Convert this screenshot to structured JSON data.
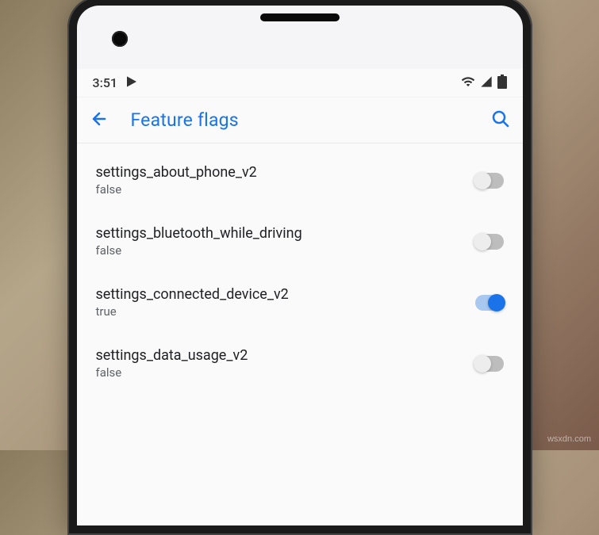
{
  "status_bar": {
    "time": "3:51",
    "icons": {
      "play": "play-icon",
      "wifi": "wifi-icon",
      "signal": "signal-icon",
      "battery": "battery-icon"
    }
  },
  "app_bar": {
    "title": "Feature flags"
  },
  "settings": [
    {
      "name": "settings_about_phone_v2",
      "value": "false",
      "enabled": false
    },
    {
      "name": "settings_bluetooth_while_driving",
      "value": "false",
      "enabled": false
    },
    {
      "name": "settings_connected_device_v2",
      "value": "true",
      "enabled": true
    },
    {
      "name": "settings_data_usage_v2",
      "value": "false",
      "enabled": false
    }
  ],
  "watermark": "wsxdn.com"
}
